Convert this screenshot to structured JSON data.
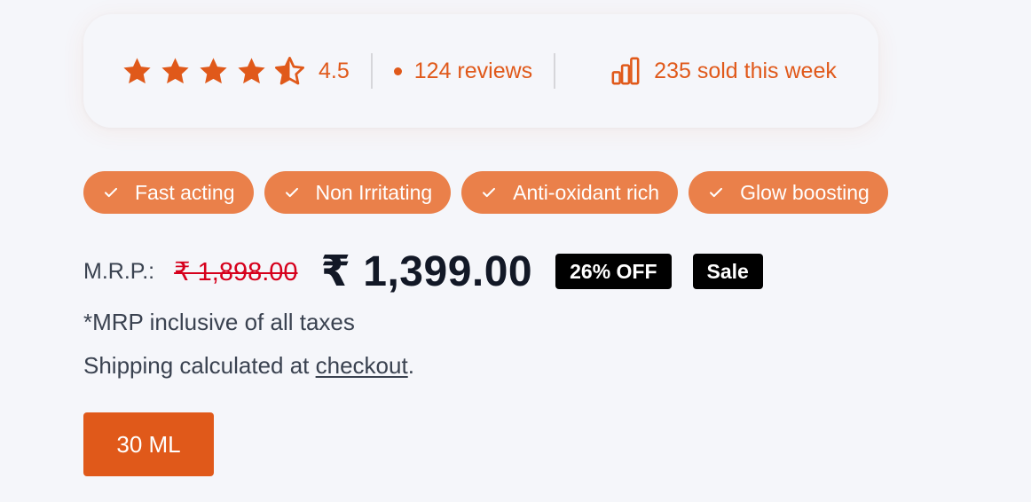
{
  "colors": {
    "accent": "#e0591a",
    "badge_bg": "#ea804a",
    "strike_price": "#d6001c",
    "background": "#f5f6fa",
    "tag_bg": "#000000"
  },
  "rating": {
    "stars_filled": 4,
    "stars_half": 1,
    "stars_total": 5,
    "value": "4.5",
    "star_icon": "star-icon",
    "half_star_icon": "star-half-icon"
  },
  "reviews": {
    "icon": "dot-icon",
    "label": "124 reviews"
  },
  "sold": {
    "icon": "bar-chart-icon",
    "label": "235 sold this week"
  },
  "benefits": [
    {
      "icon": "check-icon",
      "label": "Fast acting"
    },
    {
      "icon": "check-icon",
      "label": "Non Irritating"
    },
    {
      "icon": "check-icon",
      "label": "Anti-oxidant rich"
    },
    {
      "icon": "check-icon",
      "label": "Glow boosting"
    }
  ],
  "price": {
    "mrp_label": "M.R.P.:",
    "mrp_value": "₹ 1,898.00",
    "sale_value": "₹ 1,399.00",
    "discount_tag": "26% OFF",
    "sale_tag": "Sale"
  },
  "tax_note": "*MRP inclusive of all taxes",
  "shipping": {
    "prefix": "Shipping calculated at ",
    "link": "checkout",
    "suffix": "."
  },
  "variant": {
    "selected_label": "30 ML"
  }
}
